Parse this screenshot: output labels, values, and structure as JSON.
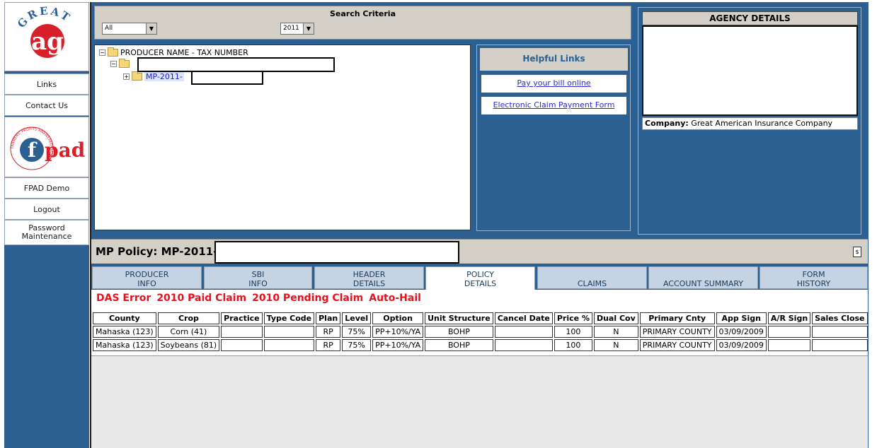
{
  "sidebar": {
    "logo_great_text": "GREAT",
    "logo_ag_text": "ag",
    "nav": [
      {
        "label": "Links"
      },
      {
        "label": "Contact Us"
      },
      {
        "label": "FPAD Demo"
      },
      {
        "label": "Logout"
      },
      {
        "label": "Password Maintenance"
      }
    ],
    "fpad_logo_text": "fpad",
    "fpad_ring_text": "FARMERS' PROFITS ANSWERED DAILY"
  },
  "search": {
    "title": "Search Criteria",
    "filter_value": "All",
    "year_value": "2011"
  },
  "tree": {
    "root_label": "PRODUCER NAME - TAX NUMBER",
    "policy_label": "MP-2011-"
  },
  "helpful": {
    "title": "Helpful Links",
    "links": [
      {
        "label": "Pay your bill online "
      },
      {
        "label": "Electronic Claim Payment Form "
      }
    ]
  },
  "agency": {
    "title": "AGENCY DETAILS",
    "company_label": "Company:",
    "company_value": "Great American Insurance Company"
  },
  "policy_header": {
    "label": "MP Policy: MP-2011-"
  },
  "tabs": [
    {
      "line1": "PRODUCER",
      "line2": "INFO"
    },
    {
      "line1": "SBI",
      "line2": "INFO"
    },
    {
      "line1": "HEADER",
      "line2": "DETAILS"
    },
    {
      "line1": "POLICY",
      "line2": "DETAILS"
    },
    {
      "line1": "",
      "line2": "CLAIMS"
    },
    {
      "line1": "",
      "line2": "ACCOUNT SUMMARY"
    },
    {
      "line1": "FORM",
      "line2": "HISTORY"
    }
  ],
  "alerts": [
    "DAS Error",
    "2010 Paid Claim",
    "2010 Pending Claim",
    "Auto-Hail"
  ],
  "colors": {
    "frame_blue": "#2c5f92",
    "alert_red": "#e8101c",
    "link_blue": "#2a2ad0"
  },
  "table": {
    "headers": [
      "County",
      "Crop",
      "Practice",
      "Type Code",
      "Plan",
      "Level",
      "Option",
      "Unit Structure",
      "Cancel Date",
      "Price %",
      "Dual Cov",
      "Primary Cnty",
      "App Sign",
      "A/R Sign",
      "Sales Close"
    ],
    "rows": [
      [
        "Mahaska (123)",
        "Corn (41)",
        "",
        "",
        "RP",
        "75%",
        "PP+10%/YA",
        "BOHP",
        "",
        "100",
        "N",
        "PRIMARY COUNTY",
        "03/09/2009",
        "",
        ""
      ],
      [
        "Mahaska (123)",
        "Soybeans (81)",
        "",
        "",
        "RP",
        "75%",
        "PP+10%/YA",
        "BOHP",
        "",
        "100",
        "N",
        "PRIMARY COUNTY",
        "03/09/2009",
        "",
        ""
      ]
    ]
  }
}
